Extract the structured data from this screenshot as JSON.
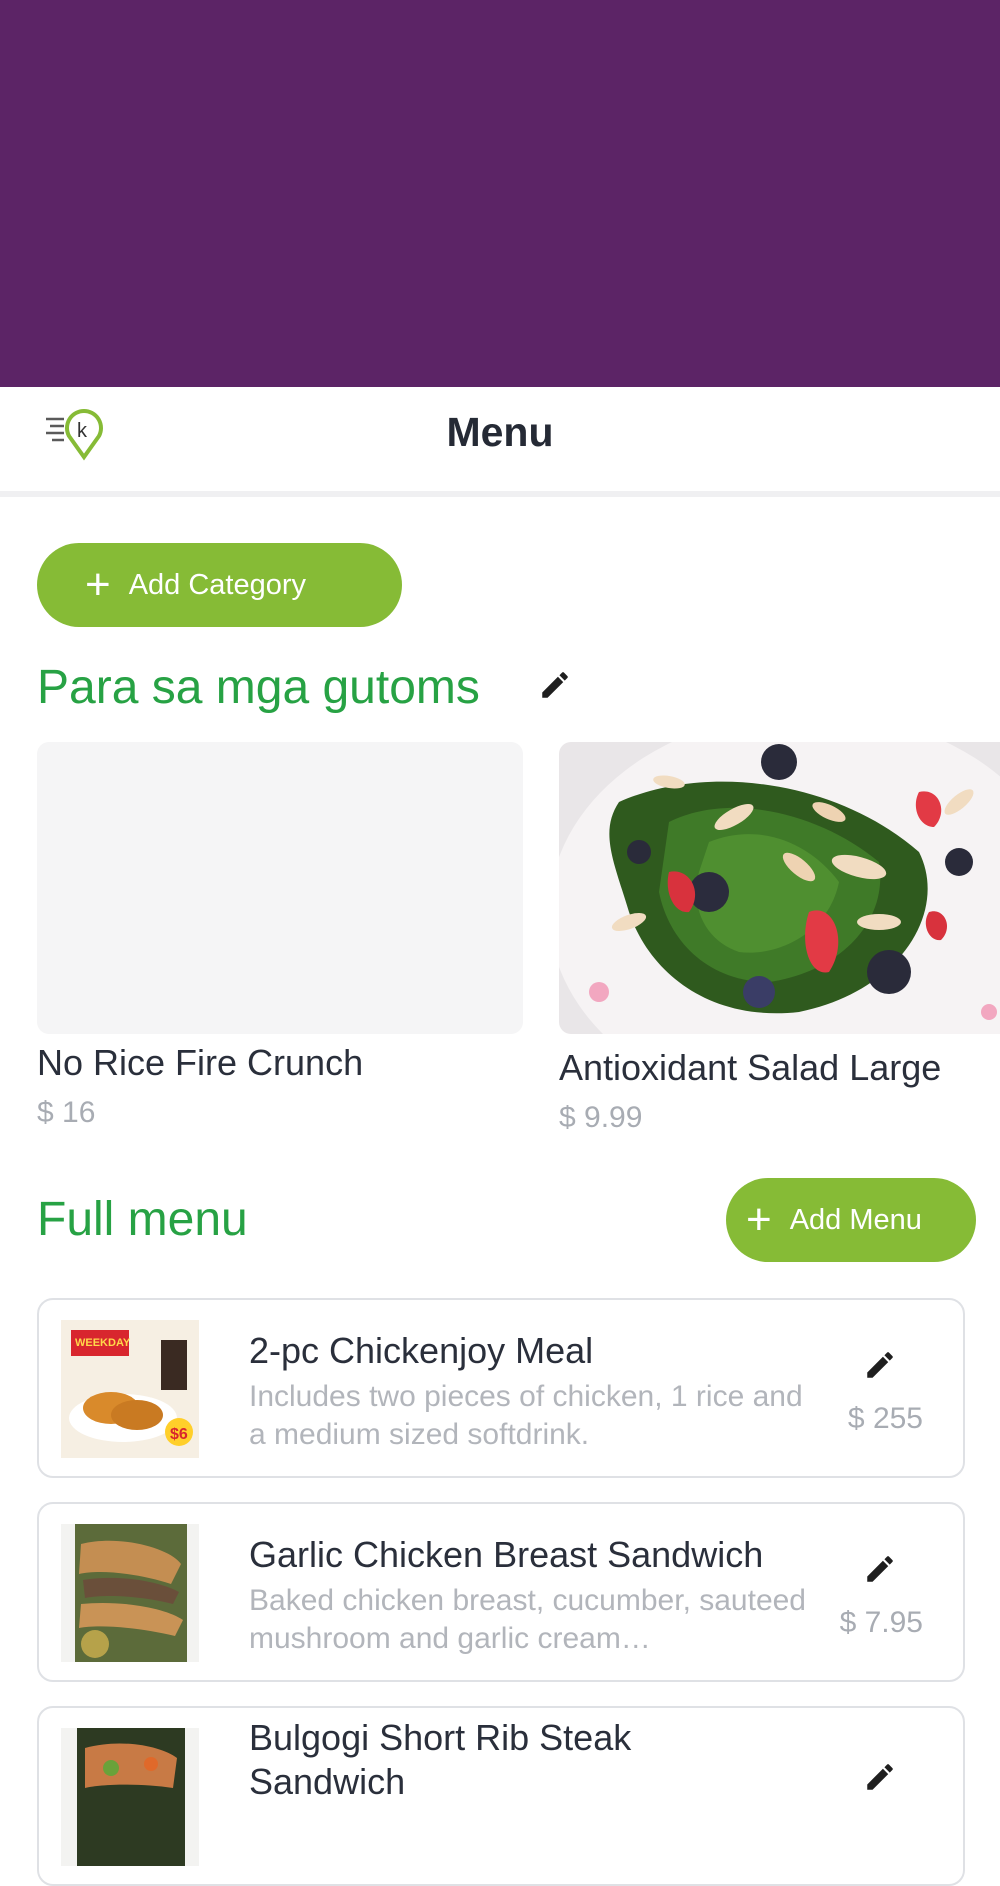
{
  "header": {
    "title": "Menu",
    "logo_icon": "kusinaph-location-logo-icon"
  },
  "colors": {
    "banner": "#5c2466",
    "accent_green": "#86bb36",
    "title_green": "#27a244"
  },
  "actions": {
    "add_category_label": "Add Category",
    "add_menu_label": "Add Menu",
    "plus_icon": "+"
  },
  "category": {
    "title": "Para sa mga gutoms",
    "cards": [
      {
        "name": "No Rice Fire Crunch",
        "price": "$ 16"
      },
      {
        "name": "Antioxidant Salad Large",
        "price": "$ 9.99"
      }
    ]
  },
  "full_menu": {
    "title": "Full menu",
    "items": [
      {
        "name": "2-pc Chickenjoy Meal",
        "description": "Includes two pieces of chicken, 1 rice and a medium sized softdrink.",
        "price": "$ 255"
      },
      {
        "name": "Garlic Chicken Breast Sandwich",
        "description": "Baked chicken breast, cucumber, sauteed mushroom and garlic cream…",
        "price": "$ 7.95"
      },
      {
        "name": "Bulgogi Short Rib Steak Sandwich",
        "description": "",
        "price": ""
      }
    ]
  }
}
